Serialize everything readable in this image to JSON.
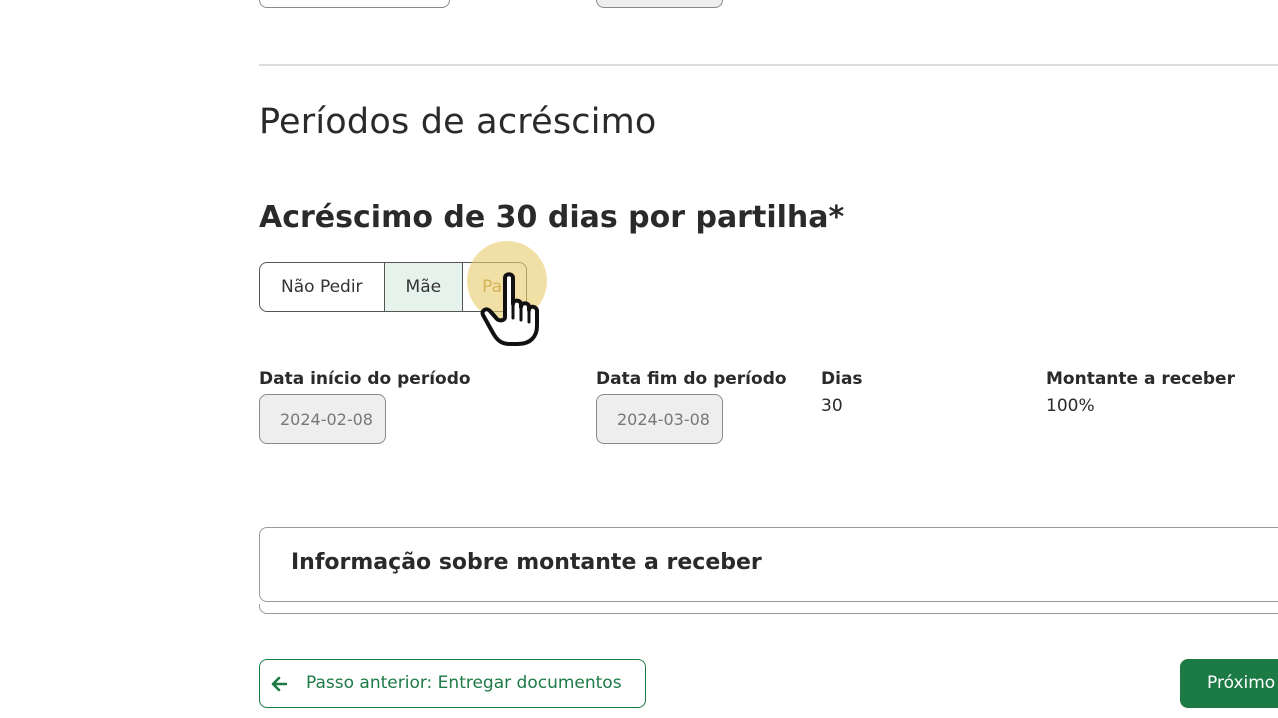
{
  "section": {
    "title": "Períodos de acréscimo",
    "question": "Acréscimo de 30 dias por partilha*"
  },
  "segmented": {
    "options": [
      "Não Pedir",
      "Mãe",
      "Pai"
    ],
    "selected": "Mãe"
  },
  "period": {
    "start_label": "Data início do período",
    "start_value": "2024-02-08",
    "end_label": "Data fim do período",
    "end_value": "2024-03-08",
    "days_label": "Dias",
    "days_value": "30",
    "amount_label": "Montante a receber",
    "amount_value": "100%"
  },
  "accordion": {
    "title": "Informação sobre montante a receber"
  },
  "nav": {
    "prev_label": "Passo anterior: Entregar documentos",
    "next_label": "Próximo"
  },
  "colors": {
    "primary": "#1c7a45",
    "selected_bg": "#e6f2ec",
    "cursor_halo": "#e8cd6e"
  },
  "icons": {
    "prev": "arrow-left-icon",
    "cursor": "hand-pointer-icon"
  }
}
